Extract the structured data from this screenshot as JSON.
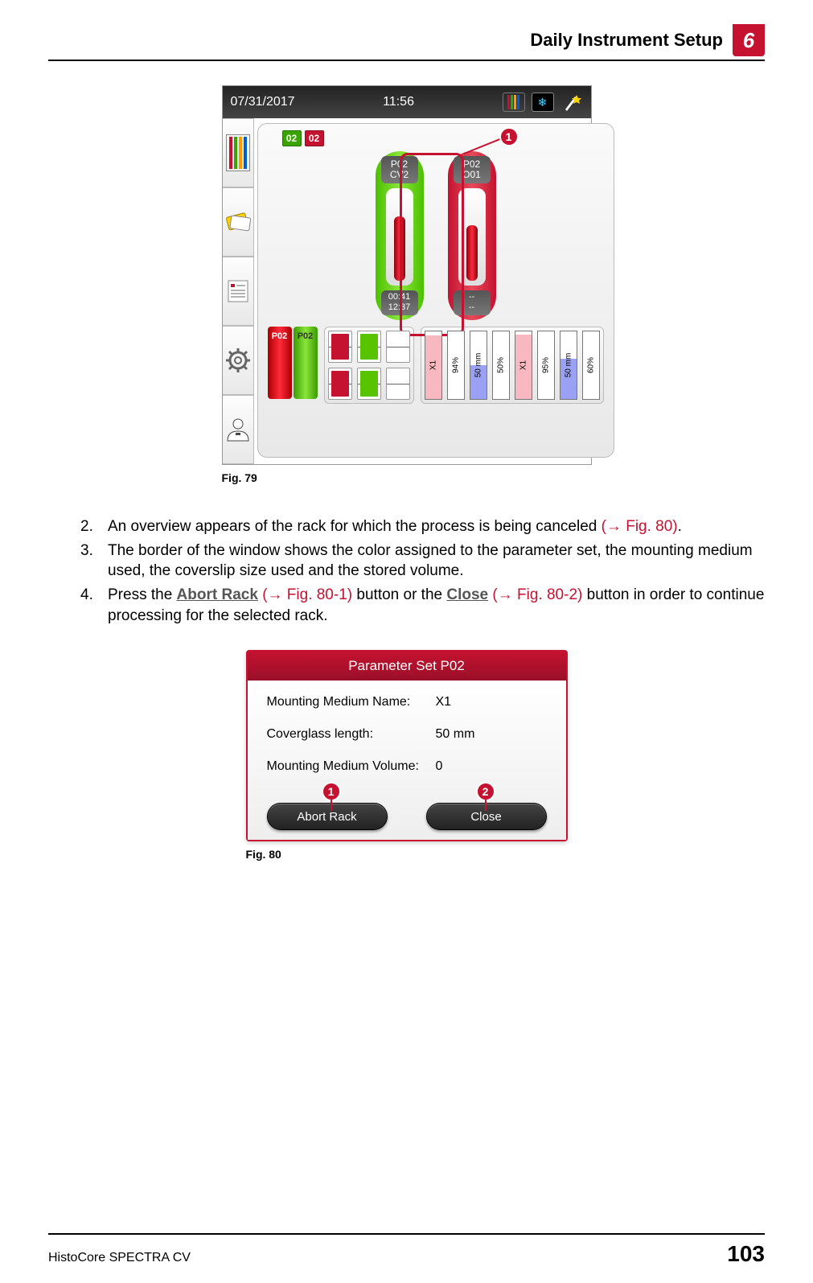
{
  "header": {
    "title": "Daily Instrument Setup",
    "chapter": "6"
  },
  "fig79": {
    "caption": "Fig.  79",
    "statusbar": {
      "date": "07/31/2017",
      "time": "11:56"
    },
    "top_badges": [
      "02",
      "02"
    ],
    "line_left": {
      "top1": "P02",
      "top2": "CV2",
      "foot1": "00:41",
      "foot2": "12:37"
    },
    "line_right": {
      "top1": "P02",
      "top2": "O01",
      "foot1": "--",
      "foot2": "--"
    },
    "callout": "1",
    "racks": [
      "P02",
      "P02"
    ],
    "vbars": [
      {
        "label": "X1",
        "percent": "94%",
        "fill": 94,
        "color": "pink"
      },
      {
        "label": "50 mm",
        "percent": "50%",
        "fill": 50,
        "color": "blue"
      },
      {
        "label": "X1",
        "percent": "95%",
        "fill": 95,
        "color": "pink"
      },
      {
        "label": "50 mm",
        "percent": "60%",
        "fill": 60,
        "color": "blue"
      }
    ]
  },
  "list": {
    "i2": {
      "n": "2.",
      "a": "An overview appears of the rack for which the process is being canceled ",
      "ref": "(→ Fig.  80)",
      "b": "."
    },
    "i3": {
      "n": "3.",
      "a": "The border of the window shows the color assigned to the parameter set, the mounting medium used, the coverslip size used and the stored volume."
    },
    "i4": {
      "n": "4.",
      "a": "Press the ",
      "abort": "Abort Rack",
      "ref1": "(→ Fig.  80-",
      "ref1n": "1",
      "ref1b": ")",
      "mid": " button or the ",
      "close": "Close",
      "ref2": "(→ Fig.  80-",
      "ref2n": "2",
      "ref2b": ")",
      "end": " button in order to continue processing for the selected rack."
    }
  },
  "fig80": {
    "caption": "Fig.  80",
    "title": "Parameter Set P02",
    "rows": {
      "r1k": "Mounting Medium Name:",
      "r1v": "X1",
      "r2k": "Coverglass length:",
      "r2v": "50 mm",
      "r3k": "Mounting Medium Volume:",
      "r3v": "0"
    },
    "btn_abort": "Abort Rack",
    "btn_close": "Close",
    "callout1": "1",
    "callout2": "2"
  },
  "footer": {
    "doc": "HistoCore SPECTRA CV",
    "page": "103"
  }
}
